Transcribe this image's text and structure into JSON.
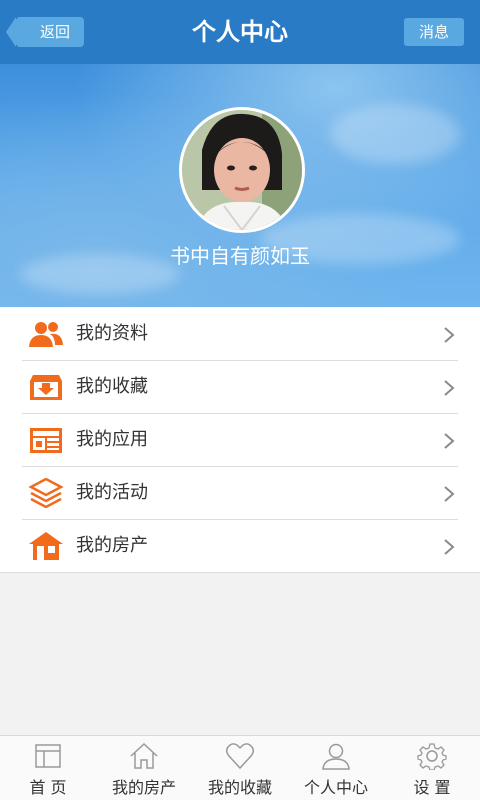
{
  "header": {
    "back_label": "返回",
    "title": "个人中心",
    "message_label": "消息"
  },
  "profile": {
    "username": "书中自有颜如玉"
  },
  "menu": [
    {
      "label": "我的资料",
      "icon": "users-icon"
    },
    {
      "label": "我的收藏",
      "icon": "download-box-icon"
    },
    {
      "label": "我的应用",
      "icon": "newspaper-icon"
    },
    {
      "label": "我的活动",
      "icon": "layers-icon"
    },
    {
      "label": "我的房产",
      "icon": "house-icon"
    }
  ],
  "tabs": [
    {
      "label": "首 页",
      "icon": "window-icon"
    },
    {
      "label": "我的房产",
      "icon": "home-outline-icon"
    },
    {
      "label": "我的收藏",
      "icon": "heart-icon"
    },
    {
      "label": "个人中心",
      "icon": "person-icon"
    },
    {
      "label": "设 置",
      "icon": "gear-icon"
    }
  ],
  "colors": {
    "header": "#2a7bc6",
    "accent": "#f26b1d",
    "button": "#5aa8e0"
  }
}
